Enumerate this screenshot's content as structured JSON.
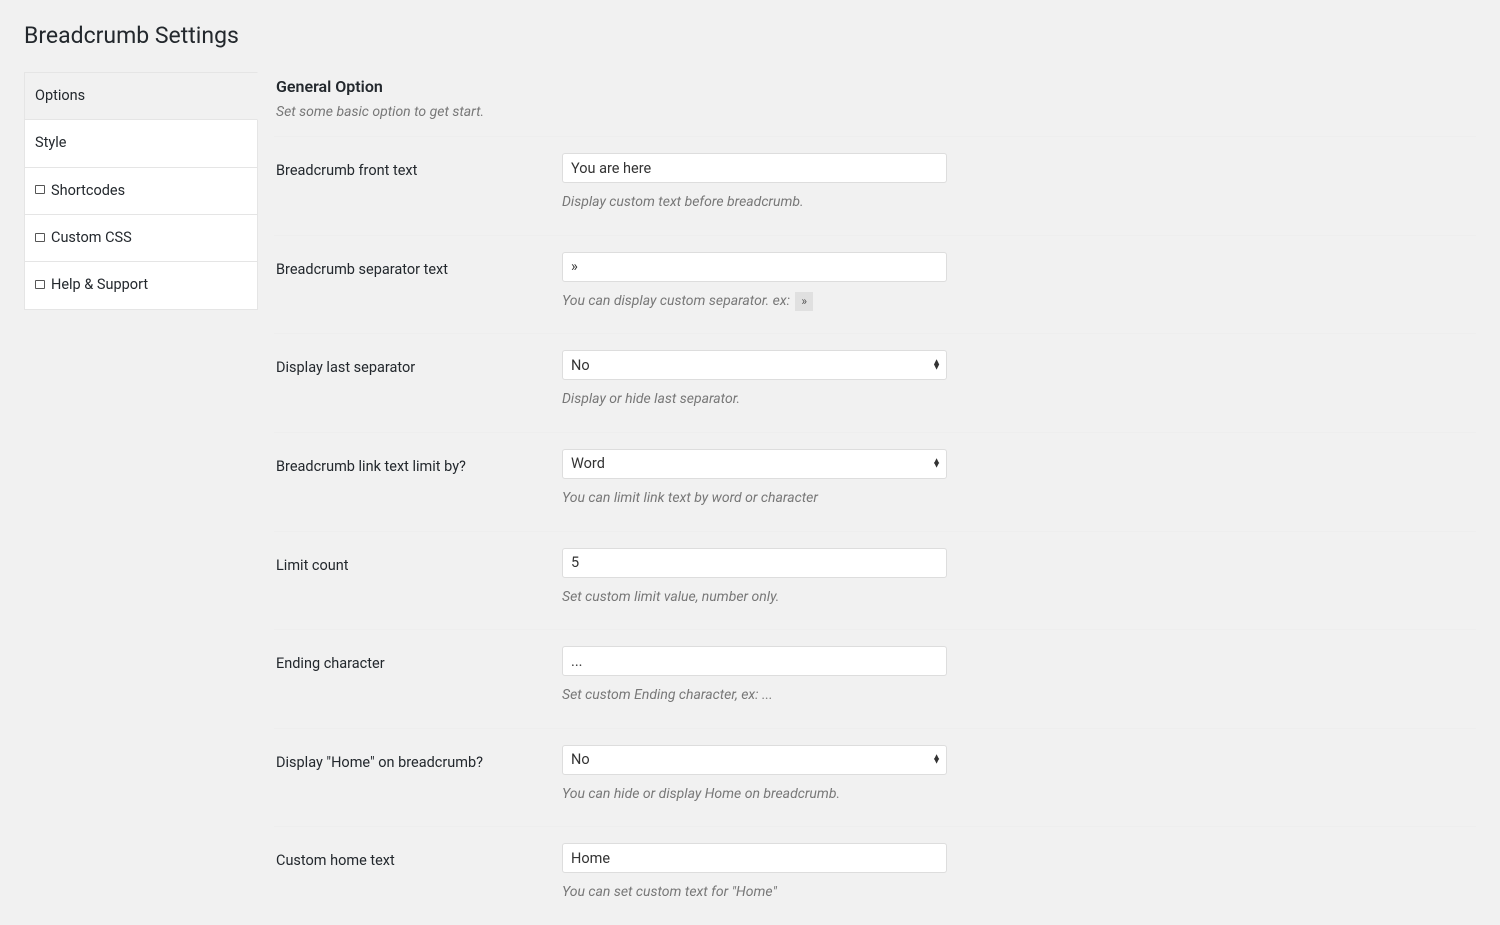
{
  "page": {
    "title": "Breadcrumb Settings"
  },
  "tabs": [
    {
      "label": "Options",
      "active": true,
      "icon": false
    },
    {
      "label": "Style",
      "active": false,
      "icon": false
    },
    {
      "label": "Shortcodes",
      "active": false,
      "icon": true
    },
    {
      "label": "Custom CSS",
      "active": false,
      "icon": true
    },
    {
      "label": "Help & Support",
      "active": false,
      "icon": true
    }
  ],
  "section": {
    "title": "General Option",
    "desc": "Set some basic option to get start."
  },
  "fields": {
    "front_text": {
      "label": "Breadcrumb front text",
      "value": "You are here",
      "help": "Display custom text before breadcrumb."
    },
    "separator": {
      "label": "Breadcrumb separator text",
      "value": "»",
      "help": "You can display custom separator. ex:",
      "chip": "»"
    },
    "last_sep": {
      "label": "Display last separator",
      "value": "No",
      "help": "Display or hide last separator."
    },
    "limit_by": {
      "label": "Breadcrumb link text limit by?",
      "value": "Word",
      "help": "You can limit link text by word or character"
    },
    "limit_count": {
      "label": "Limit count",
      "value": "5",
      "help": "Set custom limit value, number only."
    },
    "ending_char": {
      "label": "Ending character",
      "value": "...",
      "help": "Set custom Ending character, ex: ..."
    },
    "display_home": {
      "label": "Display \"Home\" on breadcrumb?",
      "value": "No",
      "help": "You can hide or display Home on breadcrumb."
    },
    "home_text": {
      "label": "Custom home text",
      "value": "Home",
      "help": "You can set custom text for \"Home\""
    }
  }
}
